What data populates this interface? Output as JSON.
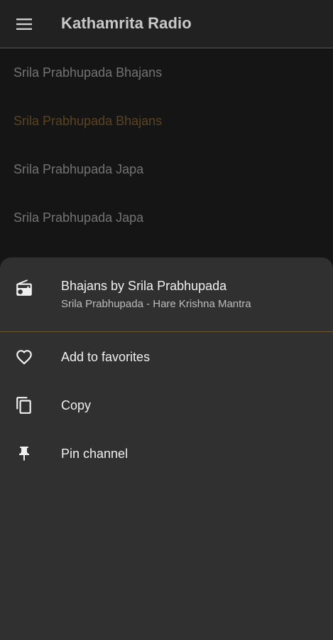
{
  "app": {
    "title": "Kathamrita Radio"
  },
  "list": {
    "items": [
      {
        "label": "Srila Prabhupada Bhajans"
      },
      {
        "label": "Srila Prabhupada Bhajans"
      },
      {
        "label": "Srila Prabhupada Japa"
      },
      {
        "label": "Srila Prabhupada Japa"
      }
    ],
    "active_index": 1
  },
  "sheet": {
    "title": "Bhajans by Srila Prabhupada",
    "subtitle": "Srila Prabhupada - Hare Krishna Mantra",
    "actions": [
      {
        "label": "Add to favorites",
        "icon": "heart-outline-icon"
      },
      {
        "label": "Copy",
        "icon": "copy-icon"
      },
      {
        "label": "Pin channel",
        "icon": "pin-icon"
      }
    ]
  },
  "colors": {
    "background": "#1c1c1c",
    "appbar": "#212121",
    "sheet": "#303030",
    "accent": "#7a5a2c",
    "divider": "#6b5530"
  }
}
